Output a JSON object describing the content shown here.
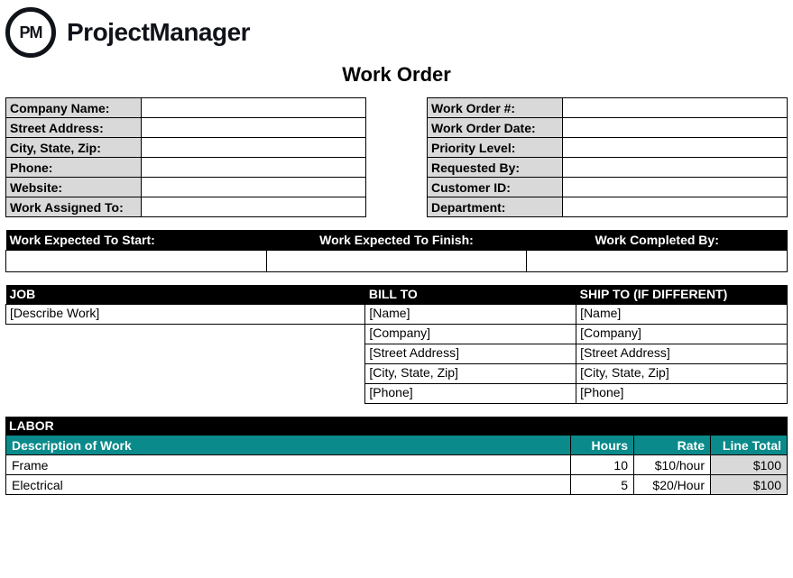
{
  "brand": {
    "logo": "PM",
    "name": "ProjectManager"
  },
  "title": "Work Order",
  "company_info": {
    "labels": {
      "company_name": "Company Name:",
      "street": "Street Address:",
      "city": "City, State, Zip:",
      "phone": "Phone:",
      "website": "Website:",
      "assigned": "Work Assigned To:"
    },
    "values": {
      "company_name": "",
      "street": "",
      "city": "",
      "phone": "",
      "website": "",
      "assigned": ""
    }
  },
  "order_info": {
    "labels": {
      "number": "Work Order #:",
      "date": "Work Order Date:",
      "priority": "Priority Level:",
      "requested": "Requested By:",
      "customer": "Customer ID:",
      "department": "Department:"
    },
    "values": {
      "number": "",
      "date": "",
      "priority": "",
      "requested": "",
      "customer": "",
      "department": ""
    }
  },
  "dates": {
    "labels": {
      "start": "Work Expected To Start:",
      "finish": "Work Expected To Finish:",
      "completed": "Work Completed By:"
    },
    "values": {
      "start": "",
      "finish": "",
      "completed": ""
    }
  },
  "job": {
    "headers": {
      "job": "JOB",
      "bill": "BILL TO",
      "ship": "SHIP TO (IF DIFFERENT)"
    },
    "describe": "[Describe Work]",
    "bill": {
      "name": "[Name]",
      "company": "[Company]",
      "street": "[Street Address]",
      "city": "[City, State, Zip]",
      "phone": "[Phone]"
    },
    "ship": {
      "name": "[Name]",
      "company": "[Company]",
      "street": "[Street Address]",
      "city": "[City, State, Zip]",
      "phone": "[Phone]"
    }
  },
  "labor": {
    "title": "LABOR",
    "headers": {
      "desc": "Description of Work",
      "hours": "Hours",
      "rate": "Rate",
      "total": "Line Total"
    },
    "rows": [
      {
        "desc": "Frame",
        "hours": "10",
        "rate": "$10/hour",
        "total": "$100"
      },
      {
        "desc": "Electrical",
        "hours": "5",
        "rate": "$20/Hour",
        "total": "$100"
      }
    ]
  }
}
